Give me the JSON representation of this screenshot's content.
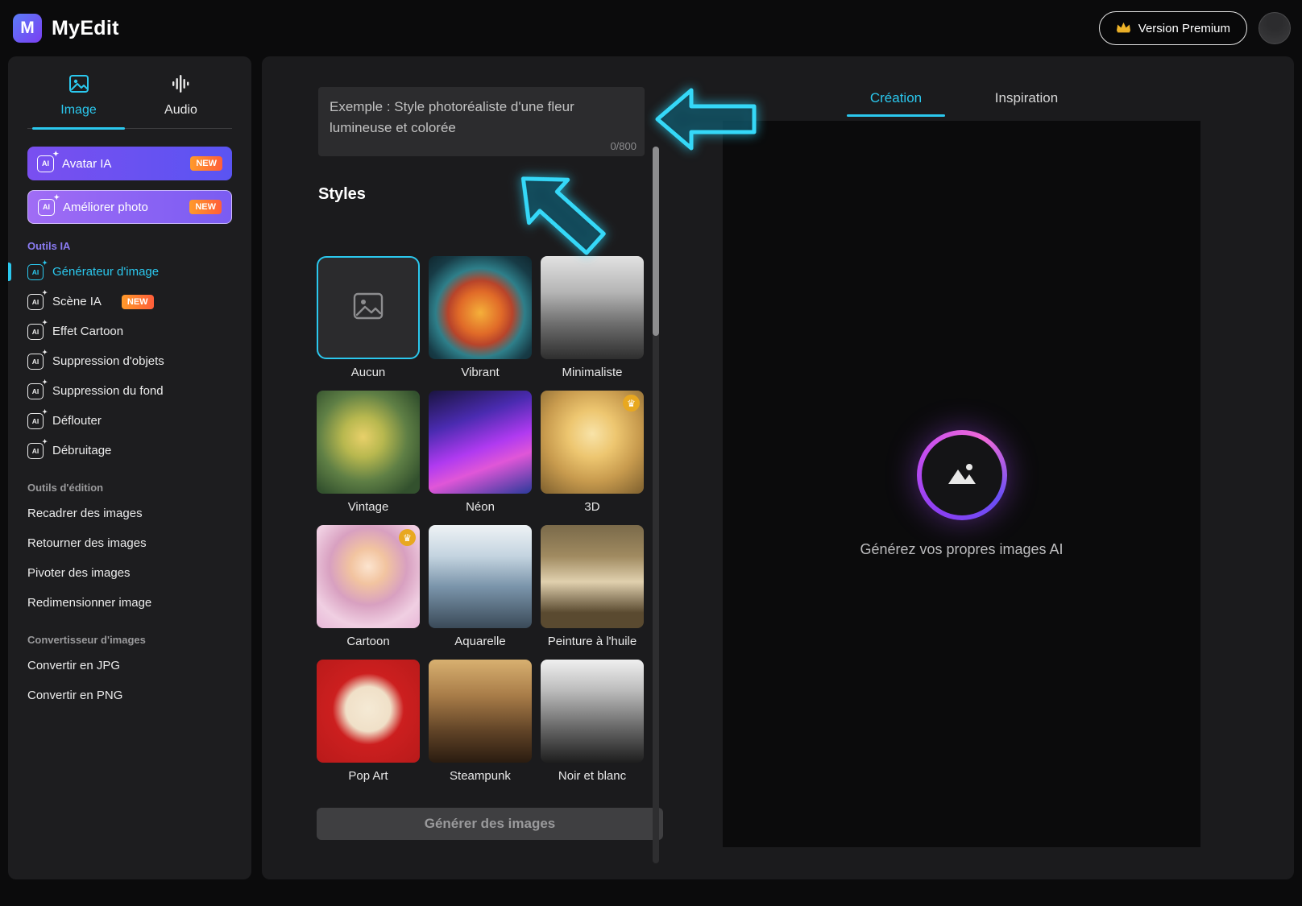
{
  "colors": {
    "accent": "#2bc8ee",
    "premium_gold": "#f0b429",
    "new_badge": "#ff7a2a"
  },
  "header": {
    "app_name": "MyEdit",
    "premium_label": "Version Premium"
  },
  "sidebar": {
    "tabs": [
      {
        "label": "Image"
      },
      {
        "label": "Audio"
      }
    ],
    "promos": [
      {
        "label": "Avatar IA",
        "badge": "NEW"
      },
      {
        "label": "Améliorer photo",
        "badge": "NEW"
      }
    ],
    "sections": [
      {
        "title": "Outils IA",
        "items": [
          {
            "label": "Générateur d'image"
          },
          {
            "label": "Scène IA",
            "badge": "NEW"
          },
          {
            "label": "Effet Cartoon"
          },
          {
            "label": "Suppression d'objets"
          },
          {
            "label": "Suppression du fond"
          },
          {
            "label": "Déflouter"
          },
          {
            "label": "Débruitage"
          }
        ]
      },
      {
        "title": "Outils d'édition",
        "items": [
          {
            "label": "Recadrer des images"
          },
          {
            "label": "Retourner des images"
          },
          {
            "label": "Pivoter des images"
          },
          {
            "label": "Redimensionner image"
          }
        ]
      },
      {
        "title": "Convertisseur d'images",
        "items": [
          {
            "label": "Convertir en JPG"
          },
          {
            "label": "Convertir en PNG"
          }
        ]
      }
    ]
  },
  "prompt": {
    "placeholder": "Exemple : Style photoréaliste d'une fleur lumineuse et colorée",
    "counter": "0/800"
  },
  "styles": {
    "title": "Styles",
    "items": [
      {
        "label": "Aucun"
      },
      {
        "label": "Vibrant"
      },
      {
        "label": "Minimaliste"
      },
      {
        "label": "Vintage"
      },
      {
        "label": "Néon"
      },
      {
        "label": "3D"
      },
      {
        "label": "Cartoon"
      },
      {
        "label": "Aquarelle"
      },
      {
        "label": "Peinture à l'huile"
      },
      {
        "label": "Pop Art"
      },
      {
        "label": "Steampunk"
      },
      {
        "label": "Noir et blanc"
      }
    ]
  },
  "generate": {
    "label": "Générer des images"
  },
  "preview": {
    "tabs": [
      {
        "label": "Création"
      },
      {
        "label": "Inspiration"
      }
    ],
    "empty_text": "Générez vos propres images AI"
  }
}
